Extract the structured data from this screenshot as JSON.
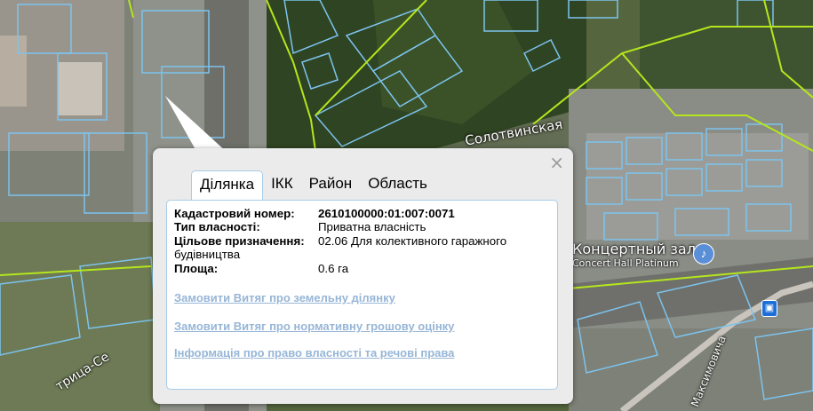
{
  "map": {
    "labels": {
      "solotvynska": "Солотвинская",
      "concert_hall": "Концертный зал",
      "concert_hall_en": "Concert Hall Platinum",
      "street_left": "трица-Се",
      "maksymovycha": "Максимовича"
    },
    "icons": [
      "music-note-icon",
      "bus-stop-icon"
    ],
    "colors": {
      "parcel_outline": "#7cc3ee",
      "boundary_line": "#b5e61d"
    }
  },
  "popup": {
    "close_glyph": "×",
    "tabs": [
      "Ділянка",
      "ІКК",
      "Район",
      "Область"
    ],
    "active_tab": "Ділянка",
    "fields": {
      "cadastral": {
        "label": "Кадастровий номер:",
        "value": "2610100000:01:007:0071"
      },
      "ownership": {
        "label": "Тип власності:",
        "value": "Приватна власність"
      },
      "purpose": {
        "label": "Цільове призначення:",
        "value": "02.06 Для колективного гаражного",
        "value_tail": "будівництва"
      },
      "area": {
        "label": "Площа:",
        "value": "0.6 га"
      }
    },
    "links": [
      "Замовити Витяг про земельну ділянку",
      "Замовити Витяг про нормативну грошову оцінку",
      "Інформація про право власності та речові права"
    ]
  }
}
